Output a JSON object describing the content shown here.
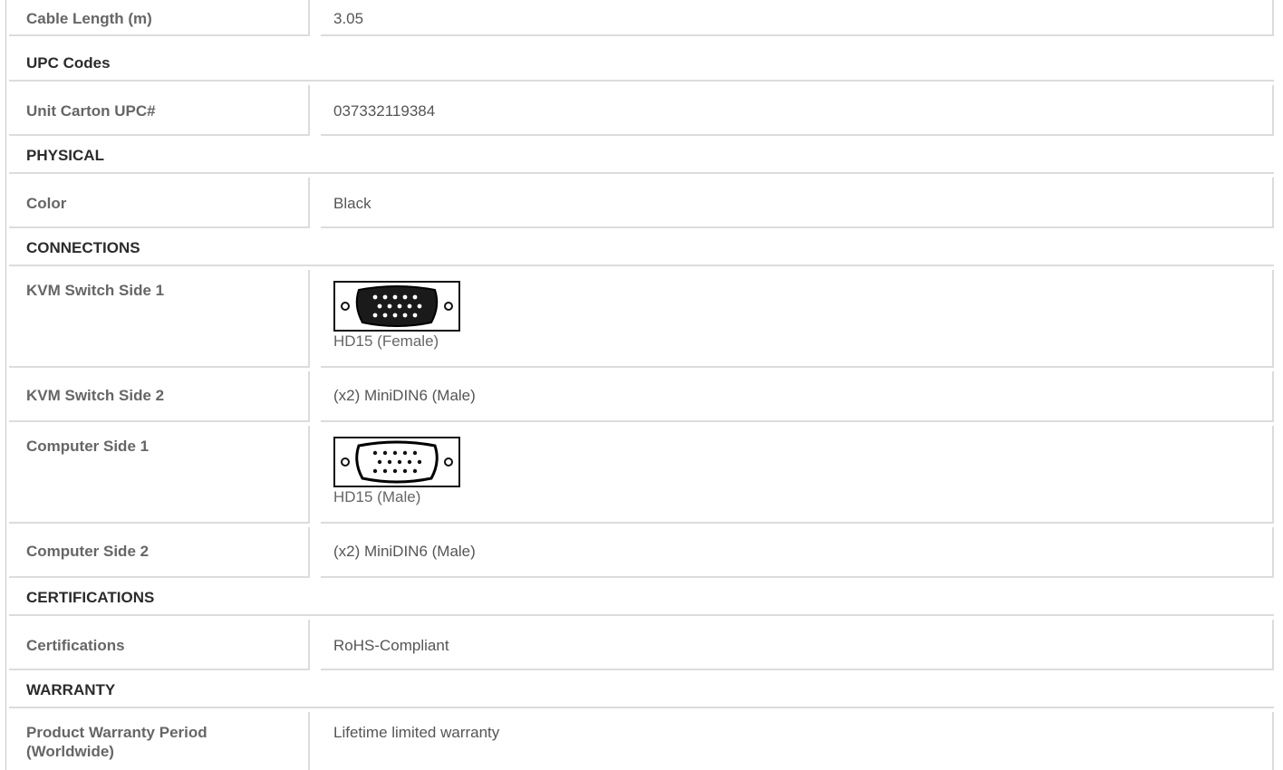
{
  "rows": {
    "cable_length": {
      "label": "Cable Length (m)",
      "value": "3.05"
    },
    "unit_carton_upc": {
      "label": "Unit Carton UPC#",
      "value": "037332119384"
    },
    "color": {
      "label": "Color",
      "value": "Black"
    },
    "kvm_side_1": {
      "label": "KVM Switch Side 1",
      "value": "HD15 (Female)",
      "icon": "hd15-female-connector-icon"
    },
    "kvm_side_2": {
      "label": "KVM Switch Side 2",
      "value": "(x2) MiniDIN6 (Male)"
    },
    "computer_side_1": {
      "label": "Computer Side 1",
      "value": "HD15 (Male)",
      "icon": "hd15-male-connector-icon"
    },
    "computer_side_2": {
      "label": "Computer Side 2",
      "value": "(x2) MiniDIN6 (Male)"
    },
    "certifications": {
      "label": "Certifications",
      "value": "RoHS-Compliant"
    },
    "warranty_period": {
      "label": "Product Warranty Period (Worldwide)",
      "value": "Lifetime limited warranty"
    }
  },
  "sections": {
    "upc_codes": "UPC Codes",
    "physical": "PHYSICAL",
    "connections": "CONNECTIONS",
    "certifications": "CERTIFICATIONS",
    "warranty": "WARRANTY"
  },
  "colors": {
    "label_text": "#666666",
    "section_text": "#2b2b2b",
    "border": "#dcdcdc"
  }
}
